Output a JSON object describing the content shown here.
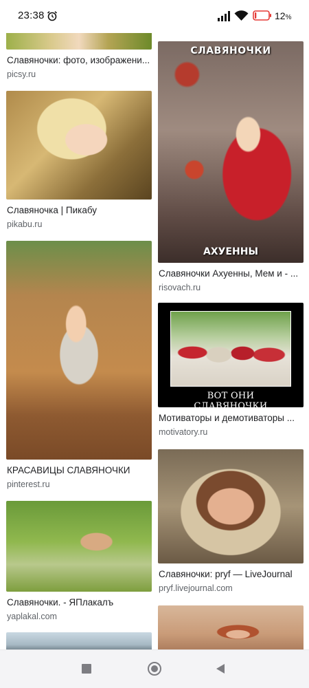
{
  "status_bar": {
    "time": "23:38",
    "battery_percent": "12",
    "battery_symbol": "%",
    "icons": [
      "alarm-icon",
      "signal-icon",
      "wifi-icon",
      "battery-icon"
    ],
    "battery_level": 0.12,
    "battery_color": "#e53935"
  },
  "results": {
    "left_column": [
      {
        "title": "Славяночки: фото, изображени...",
        "source": "picsy.ru"
      },
      {
        "title": "Славяночка | Пикабу",
        "source": "pikabu.ru"
      },
      {
        "title": "КРАСАВИЦЫ СЛАВЯНОЧКИ",
        "source": "pinterest.ru"
      },
      {
        "title": "Славяночки. - ЯПлакалъ",
        "source": "yaplakal.com"
      },
      {
        "title": "",
        "source": ""
      }
    ],
    "right_column": [
      {
        "title": "Славяночки Ахуенны, Мем и - ...",
        "source": "risovach.ru",
        "image_text_top": "СЛАВЯНОЧКИ",
        "image_text_bottom": "АХУЕННЫ"
      },
      {
        "title": "Мотиваторы и демотиваторы ...",
        "source": "motivatory.ru",
        "image_text": "ВОТ ОНИ СЛАВЯНОЧКИ"
      },
      {
        "title": "Славяночки: pryf — LiveJournal",
        "source": "pryf.livejournal.com"
      },
      {
        "title": "",
        "source": ""
      }
    ]
  },
  "nav_bar": {
    "icons": [
      "recents-icon",
      "home-icon",
      "back-icon"
    ]
  }
}
